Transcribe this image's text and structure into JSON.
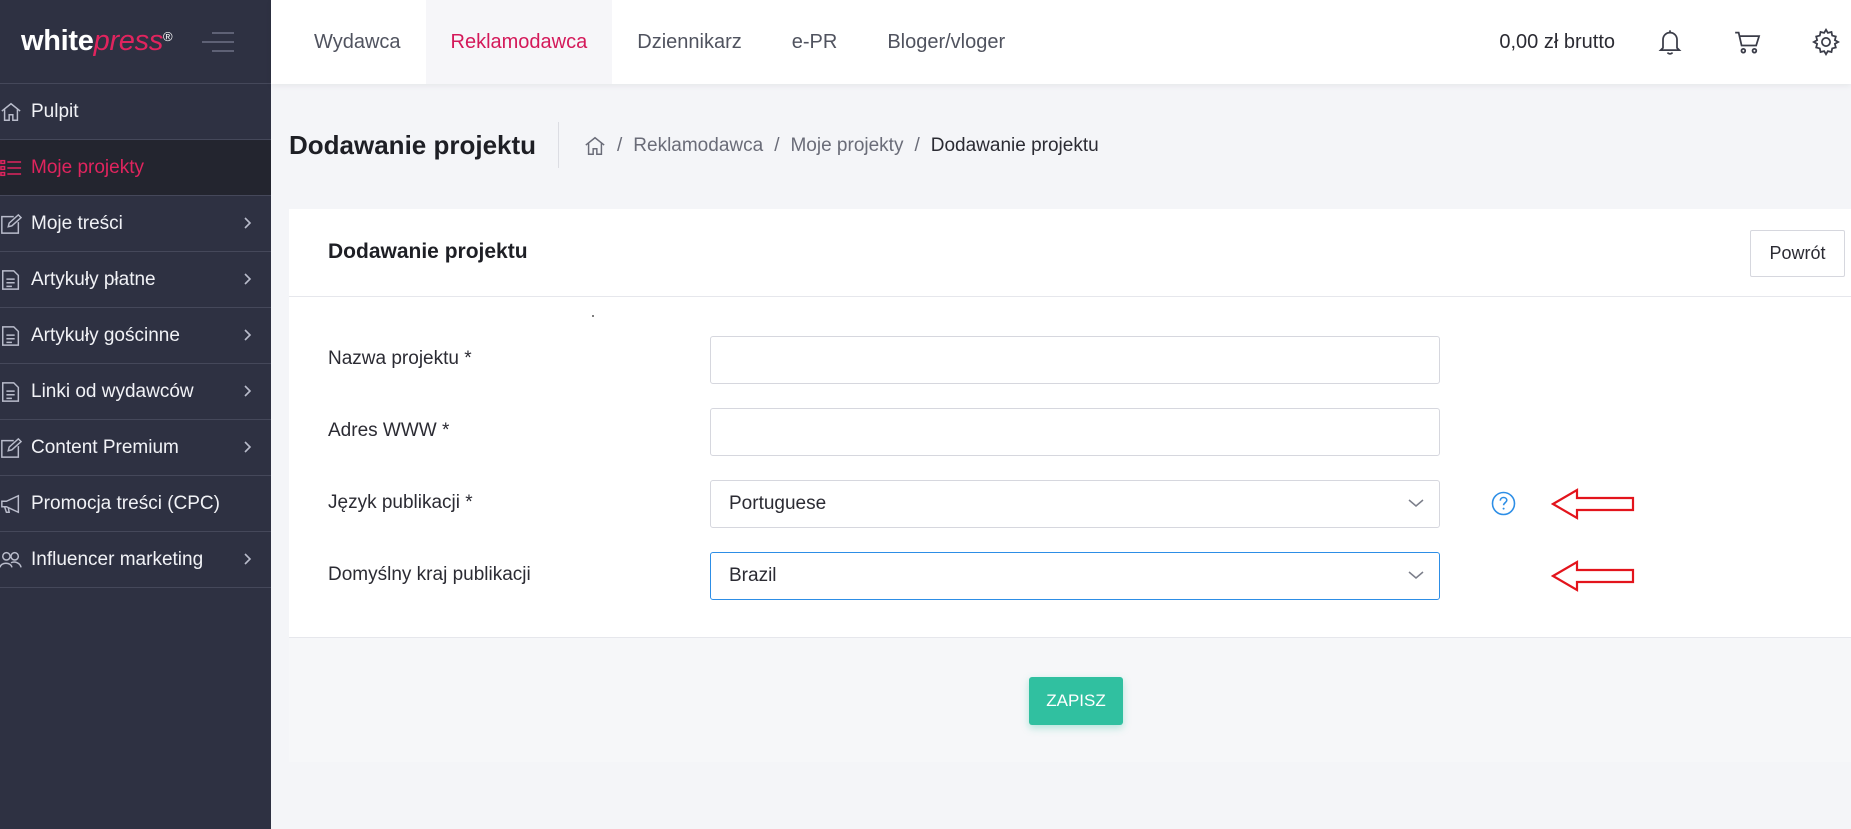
{
  "brand": {
    "white": "white",
    "press": "press",
    "reg": "®"
  },
  "sidebar": {
    "items": [
      {
        "label": "Pulpit",
        "icon": "home-icon",
        "has_chevron": false
      },
      {
        "label": "Moje projekty",
        "icon": "list-icon",
        "has_chevron": false,
        "active": true
      },
      {
        "label": "Moje treści",
        "icon": "edit-icon",
        "has_chevron": true
      },
      {
        "label": "Artykuły płatne",
        "icon": "document-icon",
        "has_chevron": true
      },
      {
        "label": "Artykuły gościnne",
        "icon": "document-icon",
        "has_chevron": true
      },
      {
        "label": "Linki od wydawców",
        "icon": "document-icon",
        "has_chevron": true
      },
      {
        "label": "Content Premium",
        "icon": "edit-icon",
        "has_chevron": true
      },
      {
        "label": "Promocja treści (CPC)",
        "icon": "megaphone-icon",
        "has_chevron": false
      },
      {
        "label": "Influencer marketing",
        "icon": "users-icon",
        "has_chevron": true
      }
    ]
  },
  "topnav": {
    "tabs": [
      {
        "label": "Wydawca"
      },
      {
        "label": "Reklamodawca",
        "active": true
      },
      {
        "label": "Dziennikarz"
      },
      {
        "label": "e-PR"
      },
      {
        "label": "Bloger/vloger"
      }
    ],
    "balance": "0,00 zł brutto",
    "icons": [
      "bell-icon",
      "cart-icon",
      "gear-icon"
    ]
  },
  "page": {
    "title": "Dodawanie projektu",
    "breadcrumb": [
      "Reklamodawca",
      "Moje projekty",
      "Dodawanie projektu"
    ]
  },
  "card": {
    "title": "Dodawanie projektu",
    "back_label": "Powrót",
    "fields": {
      "project_name": {
        "label": "Nazwa projektu *",
        "value": ""
      },
      "website": {
        "label": "Adres WWW *",
        "value": ""
      },
      "language": {
        "label": "Język publikacji *",
        "value": "Portuguese"
      },
      "country": {
        "label": "Domyślny kraj publikacji",
        "value": "Brazil"
      }
    },
    "save_label": "ZAPISZ"
  },
  "colors": {
    "sidebar_bg": "#2e3142",
    "accent": "#e0245e",
    "save_button": "#30c0a0",
    "focus_border": "#2d8ee6",
    "annotation_arrow": "#e3141c"
  }
}
